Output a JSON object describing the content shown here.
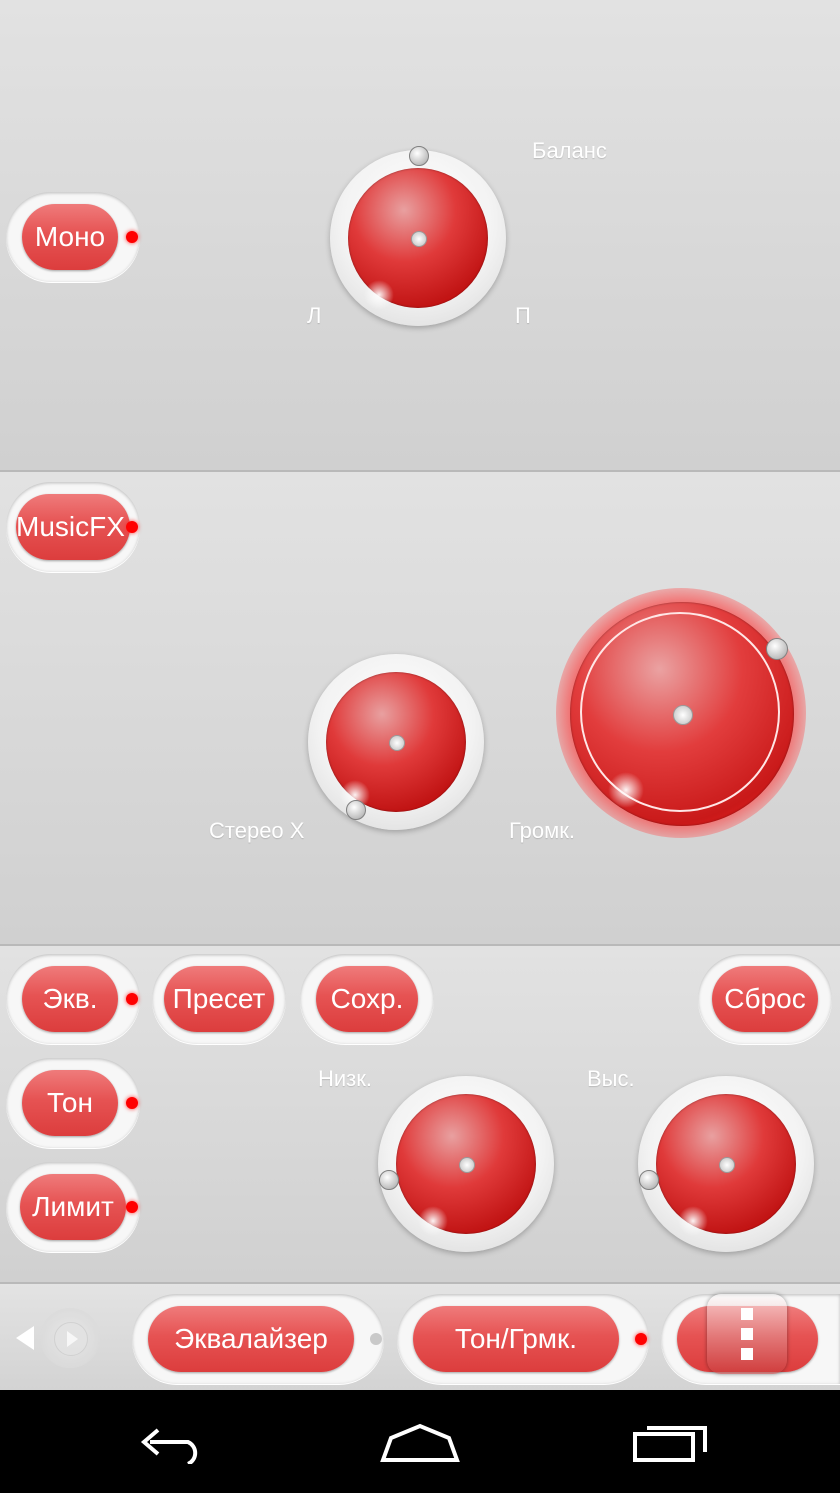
{
  "balance_panel": {
    "mono_label": "Моно",
    "balance_label": "Баланс",
    "left_label": "Л",
    "right_label": "П"
  },
  "musicfx_panel": {
    "musicfx_label": "MusicFX",
    "stereo_label": "Стерео X",
    "volume_label": "Громк."
  },
  "tone_panel": {
    "eq_label": "Экв.",
    "preset_label": "Пресет",
    "save_label": "Сохр.",
    "reset_label": "Сброс",
    "tone_label": "Тон",
    "limit_label": "Лимит",
    "bass_label": "Низк.",
    "treble_label": "Выс."
  },
  "bottom_bar": {
    "equalizer_tab": "Эквалайзер",
    "tone_volume_tab": "Тон/Грмк."
  },
  "colors": {
    "accent": "#e04545",
    "led_on": "#ff0000",
    "panel_bg": "#d6d6d6"
  }
}
